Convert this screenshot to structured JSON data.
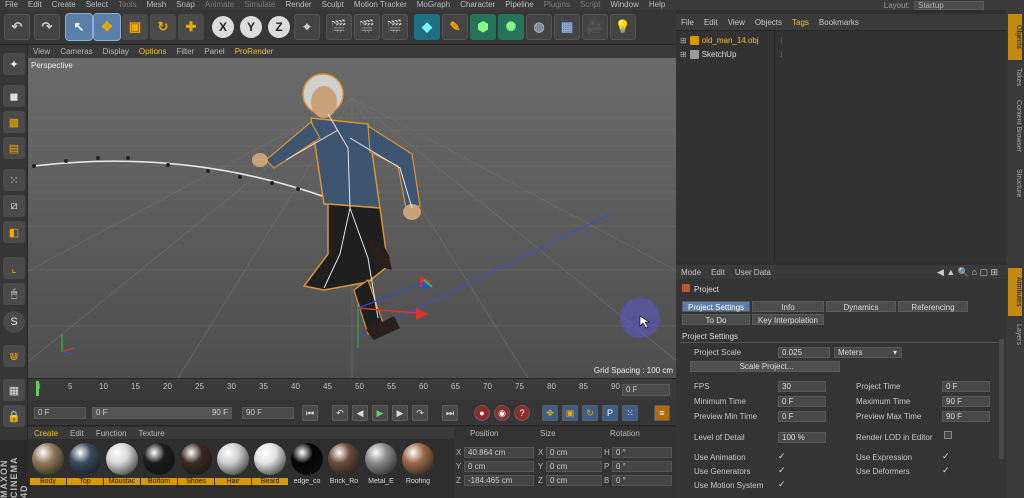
{
  "menubar": {
    "items": [
      "File",
      "Edit",
      "Create",
      "Select",
      "Tools",
      "Mesh",
      "Snap",
      "Animate",
      "Simulate",
      "Render",
      "Sculpt",
      "Motion Tracker",
      "MoGraph",
      "Character",
      "Pipeline",
      "Plugins",
      "Script",
      "Window",
      "Help"
    ],
    "layout_label": "Layout:",
    "layout_value": "Startup"
  },
  "viewport": {
    "menu": [
      "View",
      "Cameras",
      "Display",
      "Options",
      "Filter",
      "Panel",
      "ProRender"
    ],
    "label": "Perspective",
    "grid_spacing": "Grid Spacing : 100 cm"
  },
  "timeline": {
    "ticks": [
      "0",
      "5",
      "10",
      "15",
      "20",
      "25",
      "30",
      "35",
      "40",
      "45",
      "50",
      "55",
      "60",
      "65",
      "70",
      "75",
      "80",
      "85",
      "90"
    ],
    "current_frame": "0 F",
    "start": "0 F",
    "range_start": "0 F",
    "range_end": "90 F",
    "end": "90 F"
  },
  "materials": {
    "menu": [
      "Create",
      "Edit",
      "Function",
      "Texture"
    ],
    "items": [
      {
        "name": "Body",
        "color": "#8f7a5a",
        "selected": true
      },
      {
        "name": "Top",
        "color": "#3a4a5e",
        "selected": true
      },
      {
        "name": "Moustac",
        "color": "#d8d8d8",
        "selected": true
      },
      {
        "name": "Bottom",
        "color": "#1a1a1a",
        "selected": true
      },
      {
        "name": "Shoes",
        "color": "#3a2a22",
        "selected": true
      },
      {
        "name": "Hair",
        "color": "#cfcfcf",
        "selected": true
      },
      {
        "name": "Beard",
        "color": "#e2e2e2",
        "selected": true
      },
      {
        "name": "edge_co",
        "color": "#050505",
        "selected": false
      },
      {
        "name": "Brick_Ro",
        "color": "#6b4a3a",
        "selected": false
      },
      {
        "name": "Metal_E",
        "color": "#8a8a8a",
        "selected": false
      },
      {
        "name": "Roofing",
        "color": "#9a6a4a",
        "selected": false
      }
    ]
  },
  "coords": {
    "headers": [
      "Position",
      "Size",
      "Rotation"
    ],
    "rows": [
      {
        "axis": "X",
        "pos": "40.864 cm",
        "size": "0 cm",
        "rot_axis": "H",
        "rot": "0 °"
      },
      {
        "axis": "Y",
        "pos": "0 cm",
        "size": "0 cm",
        "rot_axis": "P",
        "rot": "0 °"
      },
      {
        "axis": "Z",
        "pos": "-184.465 cm",
        "size": "0 cm",
        "rot_axis": "B",
        "rot": "0 °"
      }
    ]
  },
  "objects": {
    "menu": [
      "File",
      "Edit",
      "View",
      "Objects",
      "Tags",
      "Bookmarks"
    ],
    "items": [
      "old_man_14.obj",
      "SketchUp"
    ]
  },
  "attributes": {
    "menu": [
      "Mode",
      "Edit",
      "User Data"
    ],
    "title": "Project",
    "tabs_row1": [
      "Project Settings",
      "Info",
      "Dynamics",
      "Referencing"
    ],
    "tabs_row2": [
      "To Do",
      "Key Interpolation"
    ],
    "section": "Project Settings",
    "project_scale_label": "Project Scale",
    "project_scale_value": "0.025",
    "project_scale_unit": "Meters",
    "scale_button": "Scale Project...",
    "fps_label": "FPS",
    "fps_value": "30",
    "project_time_label": "Project Time",
    "project_time_value": "0 F",
    "min_time_label": "Minimum Time",
    "min_time_value": "0 F",
    "max_time_label": "Maximum Time",
    "max_time_value": "90 F",
    "prev_min_label": "Preview Min Time",
    "prev_min_value": "0 F",
    "prev_max_label": "Preview Max Time",
    "prev_max_value": "90 F",
    "lod_label": "Level of Detail",
    "lod_value": "100 %",
    "render_lod_label": "Render LOD in Editor",
    "use_animation": "Use Animation",
    "use_expression": "Use Expression",
    "use_generators": "Use Generators",
    "use_deformers": "Use Deformers",
    "use_motion_system": "Use Motion System",
    "check": "✓"
  },
  "side_tabs": [
    "Objects",
    "Takes",
    "Content Browser",
    "Structure",
    "Attributes",
    "Layers"
  ],
  "brand": "MAXON CINEMA 4D",
  "colors": {
    "accent": "#5a7fa8",
    "highlight": "#f0c030",
    "selected_material": "#d89a00"
  }
}
